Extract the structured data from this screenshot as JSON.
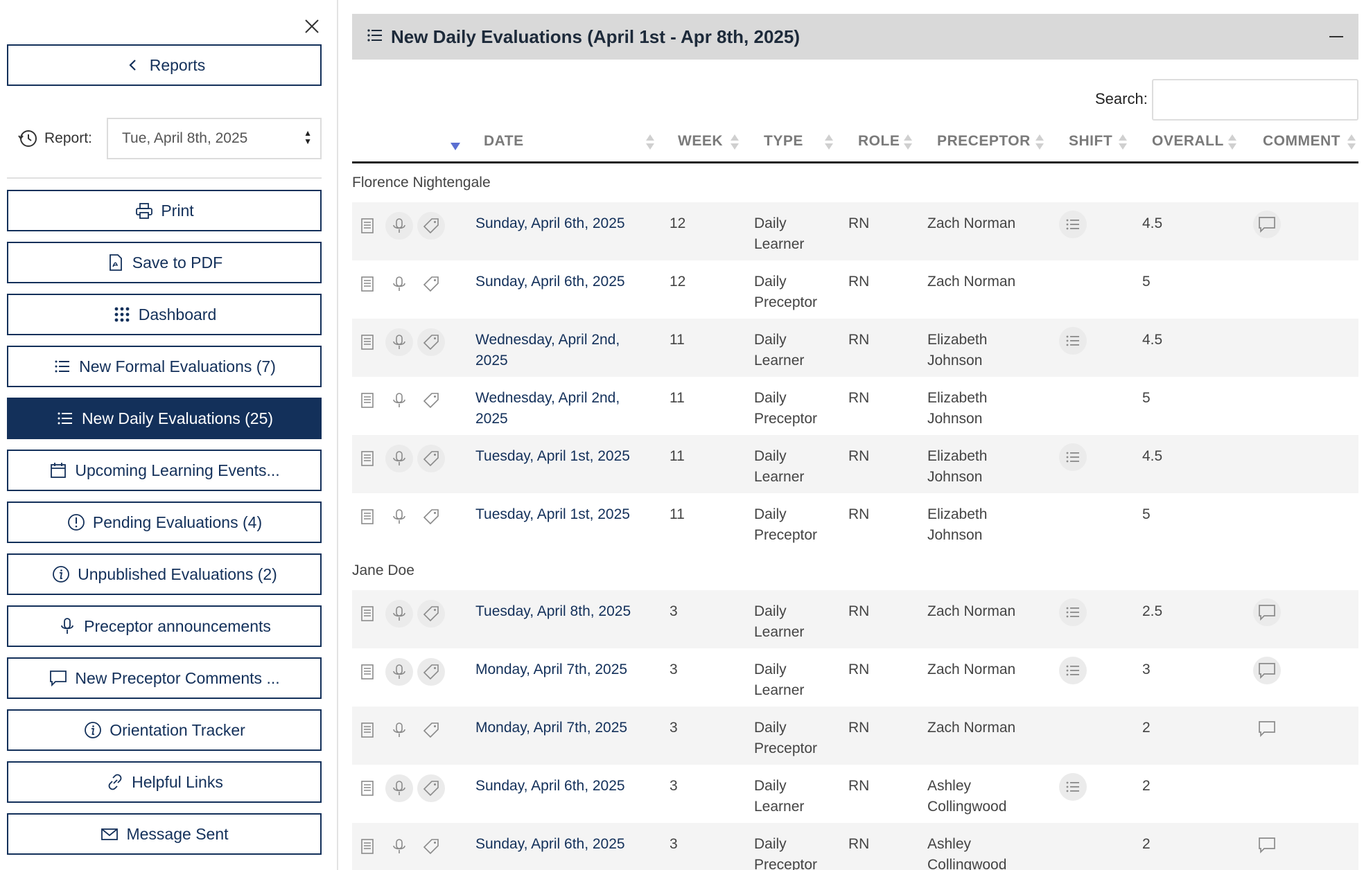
{
  "sidebar": {
    "reports_button": "Reports",
    "report_label": "Report:",
    "report_value": "Tue, April 8th, 2025",
    "buttons": [
      {
        "label": "Print",
        "icon": "printer-icon"
      },
      {
        "label": "Save to PDF",
        "icon": "pdf-icon"
      },
      {
        "label": "Dashboard",
        "icon": "grid-icon"
      },
      {
        "label": "New Formal Evaluations (7)",
        "icon": "list-icon"
      },
      {
        "label": "New Daily Evaluations (25)",
        "icon": "list-icon",
        "active": true
      },
      {
        "label": "Upcoming Learning Events...",
        "icon": "calendar-icon"
      },
      {
        "label": "Pending Evaluations (4)",
        "icon": "exclamation-circle-icon"
      },
      {
        "label": "Unpublished Evaluations (2)",
        "icon": "info-circle-icon"
      },
      {
        "label": "Preceptor announcements",
        "icon": "microphone-icon"
      },
      {
        "label": "New Preceptor Comments ...",
        "icon": "comment-icon"
      },
      {
        "label": "Orientation Tracker",
        "icon": "info-circle-icon"
      },
      {
        "label": "Helpful Links",
        "icon": "link-icon"
      },
      {
        "label": "Message Sent",
        "icon": "envelope-icon"
      }
    ]
  },
  "panel": {
    "title": "New Daily Evaluations (April 1st - Apr 8th, 2025)",
    "search_label": "Search:",
    "search_value": ""
  },
  "table": {
    "headers": {
      "date": "DATE",
      "week": "WEEK",
      "type": "TYPE",
      "role": "ROLE",
      "preceptor": "PRECEPTOR",
      "shift": "SHIFT",
      "overall": "OVERALL",
      "comment": "COMMENT"
    },
    "groups": [
      {
        "name": "Florence Nightengale",
        "rows": [
          {
            "date": "Sunday, April 6th, 2025",
            "week": "12",
            "type": "Daily Learner",
            "role": "RN",
            "preceptor": "Zach Norman",
            "shift": true,
            "overall": "4.5",
            "comment": true
          },
          {
            "date": "Sunday, April 6th, 2025",
            "week": "12",
            "type": "Daily Preceptor",
            "role": "RN",
            "preceptor": "Zach Norman",
            "shift": false,
            "overall": "5",
            "comment": false
          },
          {
            "date": "Wednesday, April 2nd, 2025",
            "week": "11",
            "type": "Daily Learner",
            "role": "RN",
            "preceptor": "Elizabeth Johnson",
            "shift": true,
            "overall": "4.5",
            "comment": false
          },
          {
            "date": "Wednesday, April 2nd, 2025",
            "week": "11",
            "type": "Daily Preceptor",
            "role": "RN",
            "preceptor": "Elizabeth Johnson",
            "shift": false,
            "overall": "5",
            "comment": false
          },
          {
            "date": "Tuesday, April 1st, 2025",
            "week": "11",
            "type": "Daily Learner",
            "role": "RN",
            "preceptor": "Elizabeth Johnson",
            "shift": true,
            "overall": "4.5",
            "comment": false
          },
          {
            "date": "Tuesday, April 1st, 2025",
            "week": "11",
            "type": "Daily Preceptor",
            "role": "RN",
            "preceptor": "Elizabeth Johnson",
            "shift": false,
            "overall": "5",
            "comment": false
          }
        ]
      },
      {
        "name": "Jane Doe",
        "rows": [
          {
            "date": "Tuesday, April 8th, 2025",
            "week": "3",
            "type": "Daily Learner",
            "role": "RN",
            "preceptor": "Zach Norman",
            "shift": true,
            "overall": "2.5",
            "comment": true
          },
          {
            "date": "Monday, April 7th, 2025",
            "week": "3",
            "type": "Daily Learner",
            "role": "RN",
            "preceptor": "Zach Norman",
            "shift": true,
            "overall": "3",
            "comment": true
          },
          {
            "date": "Monday, April 7th, 2025",
            "week": "3",
            "type": "Daily Preceptor",
            "role": "RN",
            "preceptor": "Zach Norman",
            "shift": false,
            "overall": "2",
            "comment": true
          },
          {
            "date": "Sunday, April 6th, 2025",
            "week": "3",
            "type": "Daily Learner",
            "role": "RN",
            "preceptor": "Ashley Collingwood",
            "shift": true,
            "overall": "2",
            "comment": false
          },
          {
            "date": "Sunday, April 6th, 2025",
            "week": "3",
            "type": "Daily Preceptor",
            "role": "RN",
            "preceptor": "Ashley Collingwood",
            "shift": false,
            "overall": "2",
            "comment": true
          }
        ]
      }
    ]
  },
  "colors": {
    "primary": "#13305a",
    "header_bg": "#d9d9d9",
    "sort_active": "#5b6fd1",
    "row_alt": "#f4f4f4"
  }
}
